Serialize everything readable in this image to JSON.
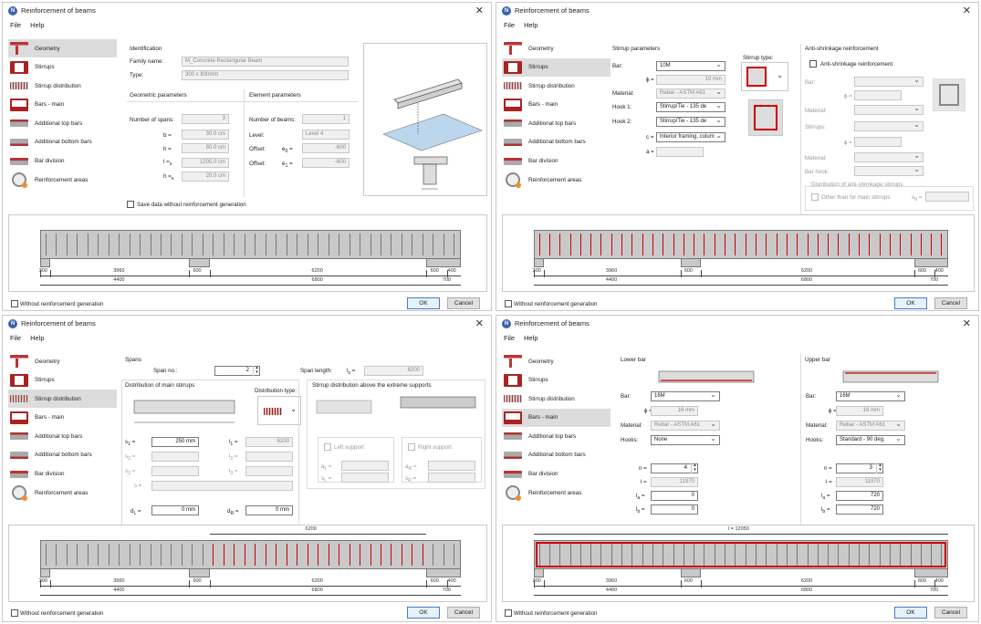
{
  "windows": [
    {
      "title": "Reinforcement of beams",
      "menu": [
        "File",
        "Help"
      ],
      "selected": 0,
      "bottom": {
        "checkbox_label": "Without reinforcement generation",
        "ok": "OK",
        "cancel": "Cancel"
      },
      "content": {
        "identification_head": "Identification",
        "family_label": "Family name:",
        "family_value": "M_Concrete-Rectangular Beam",
        "type_label": "Type:",
        "type_value": "300 x 800mm",
        "geometric_head": "Geometric parameters",
        "element_head": "Element parameters",
        "spans_label": "Number of spans:",
        "spans_value": "3",
        "b_label": "b =",
        "b_value": "30.0 cm",
        "h_label": "h =",
        "h_value": "80.0 cm",
        "l_label": "l =",
        "l_sub": "s",
        "l_value": "1205.0 cm",
        "hs_label": "h =",
        "hs_sub": "s",
        "hs_value": "20.0 cm",
        "beams_label": "Number of beams:",
        "beams_value": "1",
        "level_label": "Level:",
        "level_value": "Level 4",
        "offset_label": "Offset:",
        "e0_label": "e",
        "e0_sub": "0",
        "e0_value": "-600",
        "e1_label": "e",
        "e1_sub": "1",
        "e1_value": "-600",
        "save_label": "Save data without reinforcement generation"
      }
    },
    {
      "title": "Reinforcement of beams",
      "menu": [
        "File",
        "Help"
      ],
      "selected": 1,
      "bottom": {
        "checkbox_label": "Without reinforcement generation",
        "ok": "OK",
        "cancel": "Cancel"
      },
      "content": {
        "stirrup_head": "Stirrup parameters",
        "stirrup_type_label": "Stirrup type:",
        "bar_label": "Bar:",
        "bar_value": "10M",
        "phi_label": "ϕ =",
        "phi_value": "10 mm",
        "material_label": "Material:",
        "material_value": "Rebar - ASTM A61",
        "hook1_label": "Hook 1:",
        "hook1_value": "Stirrup/Tie - 135 de",
        "hook2_label": "Hook 2:",
        "hook2_value": "Stirrup/Tie - 135 de",
        "c_label": "c =",
        "c_value": "Interior framing, colum",
        "a_label": "a =",
        "anti_head": "Anti-shrinkage reinforcement",
        "anti_check": "Anti-shrinkage reinforcement",
        "a_bar_label": "Bar:",
        "a_phi_label": "ϕ =",
        "a_material_label": "Material:",
        "a_stirrups_label": "Stirrups:",
        "a_phi2_label": "ϕ =",
        "a_material2_label": "Material:",
        "a_hook_label": "Bar hook:",
        "dist_head": "Distribution of anti-shrinkage stirrups",
        "other_label": "Other than for main stirrups",
        "s0_label": "s",
        "s0_sub": "0",
        "s0_eq": "="
      }
    },
    {
      "title": "Reinforcement of beams",
      "menu": [
        "File",
        "Help"
      ],
      "selected": 2,
      "bottom": {
        "checkbox_label": "Without reinforcement generation",
        "ok": "OK",
        "cancel": "Cancel"
      },
      "content": {
        "spans_head": "Spans",
        "span_no_label": "Span no.:",
        "span_no_value": "2",
        "span_len_label": "Span length:",
        "ls_label": "l",
        "ls_sub": "s",
        "ls_eq": "=",
        "span_len_value": "6200",
        "dist_main_head": "Distribution of main stirrups",
        "dist_type_label": "Distribution type:",
        "above_head": "Stirrup distribution above the extreme supports",
        "s1_label": "s",
        "s1_sub": "1",
        "s1_value": "250 mm",
        "l1_label": "l",
        "l1_sub": "1",
        "l1_value": "6200",
        "s2_label": "s",
        "s2_sub": "2",
        "l2_label": "l",
        "l2_sub": "2",
        "s3_label": "s",
        "s3_sub": "3",
        "l3_label": "l",
        "l3_sub": "3",
        "s_label": "s =",
        "left_support": "Left support",
        "right_support": "Right support",
        "aL_label": "a",
        "aL_sub": "L",
        "aR_label": "a",
        "aR_sub": "R",
        "sL_label": "s",
        "sL_sub": "L",
        "sR_label": "s",
        "sR_sub": "R",
        "dL_label": "d",
        "dL_sub": "L",
        "dL_value": "0 mm",
        "dR_label": "d",
        "dR_sub": "R",
        "dR_value": "0 mm",
        "top_dim": "6200"
      }
    },
    {
      "title": "Reinforcement of beams",
      "menu": [
        "File",
        "Help"
      ],
      "selected": 3,
      "bottom": {
        "checkbox_label": "Without reinforcement generation",
        "ok": "OK",
        "cancel": "Cancel"
      },
      "content": {
        "lower_head": "Lower bar",
        "upper_head": "Upper bar",
        "bar_label": "Bar:",
        "lower_bar": "16M",
        "upper_bar": "16M",
        "phi_label": "ϕ =",
        "lower_phi": "16 mm",
        "upper_phi": "16 mm",
        "material_label": "Material:",
        "lower_material": "Rebar - ASTM A61",
        "upper_material": "Rebar - ASTM A61",
        "hooks_label": "Hooks:",
        "lower_hooks": "None",
        "upper_hooks": "Standard - 90 deg.",
        "n_label": "n =",
        "lower_n": "4",
        "upper_n": "3",
        "l_label": "l =",
        "lower_l": "11970",
        "upper_l": "11970",
        "la_label": "l",
        "la_sub": "a",
        "lower_la": "0",
        "upper_la": "720",
        "lb_label": "l",
        "lb_sub": "b",
        "lower_lb": "0",
        "upper_lb": "720",
        "top_dim": "l = 12050"
      }
    }
  ],
  "sidebar_items": [
    {
      "label": "Geometry",
      "icon": "geometry-icon"
    },
    {
      "label": "Stirrups",
      "icon": "stirrups-icon"
    },
    {
      "label": "Stirrup distribution",
      "icon": "stirrup-distribution-icon"
    },
    {
      "label": "Bars - main",
      "icon": "bars-main-icon"
    },
    {
      "label": "Additional top bars",
      "icon": "additional-top-bars-icon"
    },
    {
      "label": "Additional bottom bars",
      "icon": "additional-bottom-bars-icon"
    },
    {
      "label": "Bar division",
      "icon": "bar-division-icon"
    },
    {
      "label": "Reinforcement areas",
      "icon": "reinforcement-areas-icon"
    }
  ],
  "preview_dims": {
    "row1": [
      "300",
      "3960",
      "600",
      "6200",
      "600",
      "400"
    ],
    "row2": [
      "4400",
      "6800",
      "700"
    ]
  },
  "colors": {
    "accent": "#3a63ad",
    "rebar": "#cc0000",
    "selected": "#dcdcdc"
  }
}
